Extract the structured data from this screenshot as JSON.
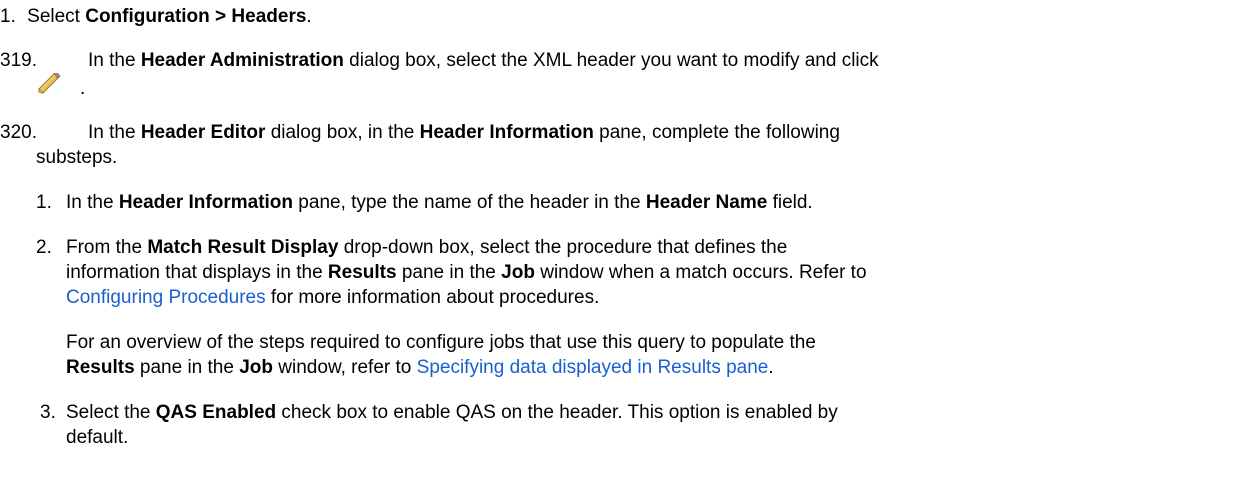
{
  "step1": {
    "num": "1.",
    "text": "Select ",
    "bold": "Configuration > Headers",
    "end": "."
  },
  "step319": {
    "num": "319.",
    "t1": "In the ",
    "b1": "Header Administration",
    "t2": " dialog box, select the XML header you want to modify and click",
    "icon": "pencil-edit-icon",
    "end": "."
  },
  "step320": {
    "num": "320.",
    "t1": "In the ",
    "b1": "Header Editor",
    "t2": " dialog box, in the ",
    "b2": "Header Information",
    "t3": " pane, complete the following",
    "line2": "substeps."
  },
  "sub1": {
    "num": "1.",
    "t1": "In the ",
    "b1": "Header Information",
    "t2": " pane, type the name of the header in the ",
    "b2": "Header Name",
    "t3": " field."
  },
  "sub2": {
    "num": "2.",
    "t1": "From the ",
    "b1": "Match Result Display",
    "t2": " drop-down box, select the procedure that defines the",
    "l2_t1": "information that displays in the ",
    "l2_b1": "Results",
    "l2_t2": " pane in the ",
    "l2_b2": "Job",
    "l2_t3": " window when a match occurs. Refer to",
    "link1": "Configuring Procedures",
    "l3_t1": " for more information about procedures.",
    "p2_l1": "For an overview of the steps required to configure jobs that use this query to populate the",
    "p2_b1": "Results",
    "p2_t1": " pane in the ",
    "p2_b2": "Job",
    "p2_t2": " window, refer to ",
    "link2": "Specifying data displayed in Results pane",
    "p2_end": "."
  },
  "sub3": {
    "num": "3.",
    "t1": "Select the ",
    "b1": "QAS Enabled",
    "t2": " check box to enable QAS on the header. This option is enabled by",
    "line2": "default."
  },
  "colors": {
    "link": "#1a5fd0",
    "text": "#000000",
    "pencil_body": "#e8c24a",
    "pencil_tip": "#b07a2a"
  }
}
